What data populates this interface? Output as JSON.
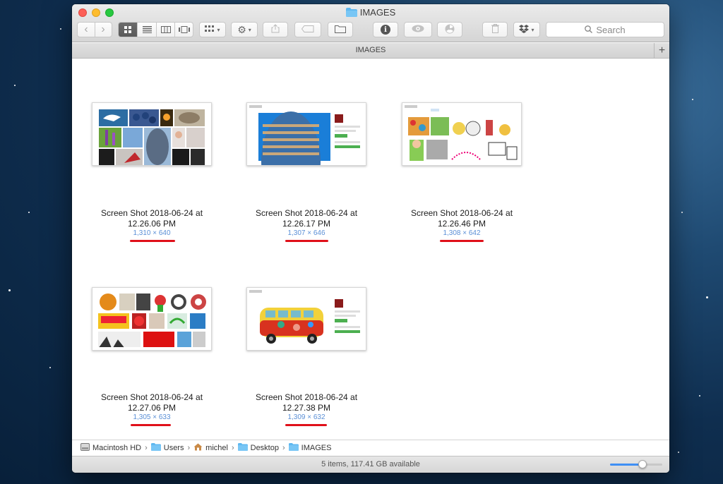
{
  "window": {
    "title": "IMAGES",
    "tab_label": "IMAGES"
  },
  "toolbar": {
    "search_placeholder": "Search",
    "view_mode": "icon",
    "icons": [
      "back-icon",
      "forward-icon",
      "icon-view-icon",
      "list-view-icon",
      "column-view-icon",
      "cover-flow-icon",
      "arrange-icon",
      "gear-icon",
      "share-icon",
      "tag-icon",
      "new-folder-icon",
      "info-icon",
      "quicklook-icon",
      "radiation-icon",
      "trash-icon",
      "dropbox-icon"
    ]
  },
  "files": [
    {
      "name_line1": "Screen Shot 2018-06-24 at",
      "name_line2": "12.26.06 PM",
      "dims": "1,310 × 640"
    },
    {
      "name_line1": "Screen Shot 2018-06-24 at",
      "name_line2": "12.26.17 PM",
      "dims": "1,307 × 646"
    },
    {
      "name_line1": "Screen Shot 2018-06-24 at",
      "name_line2": "12.26.46 PM",
      "dims": "1,308 × 642"
    },
    {
      "name_line1": "Screen Shot 2018-06-24 at",
      "name_line2": "12.27.06 PM",
      "dims": "1,305 × 633"
    },
    {
      "name_line1": "Screen Shot 2018-06-24 at",
      "name_line2": "12.27.38 PM",
      "dims": "1,309 × 632"
    }
  ],
  "path": [
    "Macintosh HD",
    "Users",
    "michel",
    "Desktop",
    "IMAGES"
  ],
  "status": {
    "text": "5 items, 117.41 GB available",
    "zoom_level": 0.62
  },
  "colors": {
    "accent": "#3f8ff5",
    "dims_text": "#5a8fd6",
    "annotation": "#e0101a"
  }
}
